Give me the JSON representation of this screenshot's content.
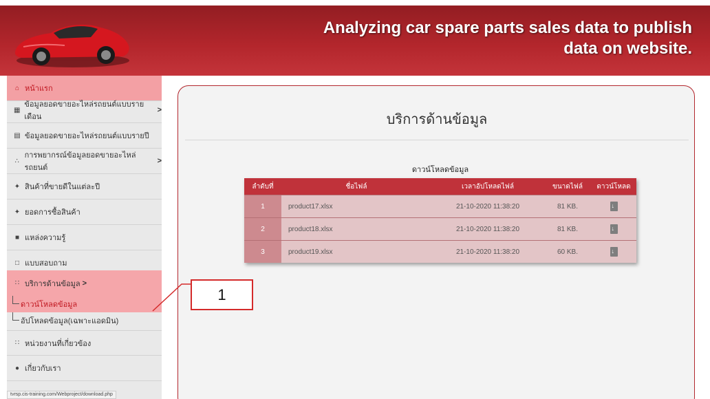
{
  "header": {
    "title_line1": "Analyzing car spare parts sales data to publish",
    "title_line2": "data on website."
  },
  "sidebar": {
    "items": [
      {
        "icon": "home-icon",
        "label": "หน้าแรก"
      },
      {
        "icon": "calendar-icon",
        "label": "ข้อมูลยอดขายอะไหล่รถยนต์แบบรายเดือน",
        "chevron": ">"
      },
      {
        "icon": "calendar-icon",
        "label": "ข้อมูลยอดขายอะไหล่รถยนต์แบบรายปี"
      },
      {
        "icon": "tree-icon",
        "label": "การพยากรณ์ข้อมูลยอดขายอะไหล่รถยนต์",
        "chevron": ">"
      },
      {
        "icon": "wrench-icon",
        "label": "สินค้าที่ขายดีในแต่ละปี"
      },
      {
        "icon": "wrench-icon",
        "label": "ยอดการซื้อสินค้า"
      },
      {
        "icon": "book-icon",
        "label": "แหล่งความรู้"
      },
      {
        "icon": "form-icon",
        "label": "แบบสอบถาม"
      },
      {
        "icon": "sitemap-icon",
        "label": "บริการด้านข้อมูล",
        "chevron": ">"
      },
      {
        "icon": "sitemap-icon",
        "label": "หน่วยงานที่เกี่ยวข้อง"
      },
      {
        "icon": "user-icon",
        "label": "เกี่ยวกับเรา"
      }
    ],
    "subitems": [
      {
        "label": "ดาวน์โหลดข้อมูล"
      },
      {
        "label": "อัปโหลดข้อมูล(เฉพาะแอดมิน)"
      }
    ],
    "status_url": "tvrsp.cis-training.com/Webproject/download.php"
  },
  "main": {
    "title": "บริการด้านข้อมูล",
    "table_caption": "ดาวน์โหลดข้อมูล",
    "columns": [
      "ลำดับที่",
      "ชื่อไฟล์",
      "เวลาอัปโหลดไฟล์",
      "ขนาดไฟล์",
      "ดาวน์โหลด"
    ],
    "rows": [
      {
        "no": "1",
        "name": "product17.xlsx",
        "time": "21-10-2020 11:38:20",
        "size": "81 KB."
      },
      {
        "no": "2",
        "name": "product18.xlsx",
        "time": "21-10-2020 11:38:20",
        "size": "81 KB."
      },
      {
        "no": "3",
        "name": "product19.xlsx",
        "time": "21-10-2020 11:38:20",
        "size": "60 KB."
      }
    ]
  },
  "annotation": {
    "label": "1"
  },
  "colors": {
    "brand": "#b3262c",
    "highlight": "#f5a6aa",
    "table_row": "#e3c5c7"
  }
}
